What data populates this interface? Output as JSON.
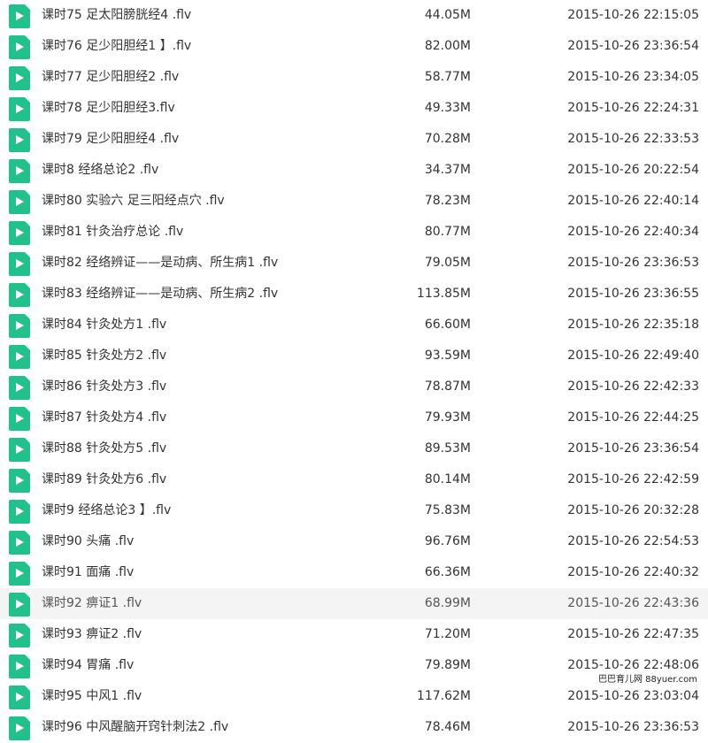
{
  "watermark": "巴巴育儿网 88yuer.com",
  "files": [
    {
      "name": "课时75 足太阳膀胱经4 .flv",
      "size": "44.05M",
      "date": "2015-10-26 22:15:05"
    },
    {
      "name": "课时76 足少阳胆经1 】.flv",
      "size": "82.00M",
      "date": "2015-10-26 23:36:54"
    },
    {
      "name": "课时77 足少阳胆经2 .flv",
      "size": "58.77M",
      "date": "2015-10-26 23:34:05"
    },
    {
      "name": "课时78 足少阳胆经3.flv",
      "size": "49.33M",
      "date": "2015-10-26 22:24:31"
    },
    {
      "name": "课时79 足少阳胆经4 .flv",
      "size": "70.28M",
      "date": "2015-10-26 22:33:53"
    },
    {
      "name": "课时8 经络总论2 .flv",
      "size": "34.37M",
      "date": "2015-10-26 20:22:54"
    },
    {
      "name": "课时80 实验六 足三阳经点穴 .flv",
      "size": "78.23M",
      "date": "2015-10-26 22:40:14"
    },
    {
      "name": "课时81 针灸治疗总论 .flv",
      "size": "80.77M",
      "date": "2015-10-26 22:40:34"
    },
    {
      "name": "课时82 经络辨证——是动病、所生病1 .flv",
      "size": "79.05M",
      "date": "2015-10-26 23:36:53"
    },
    {
      "name": "课时83 经络辨证——是动病、所生病2 .flv",
      "size": "113.85M",
      "date": "2015-10-26 23:36:55"
    },
    {
      "name": "课时84 针灸处方1 .flv",
      "size": "66.60M",
      "date": "2015-10-26 22:35:18"
    },
    {
      "name": "课时85 针灸处方2 .flv",
      "size": "93.59M",
      "date": "2015-10-26 22:49:40"
    },
    {
      "name": "课时86 针灸处方3 .flv",
      "size": "78.87M",
      "date": "2015-10-26 22:42:33"
    },
    {
      "name": "课时87 针灸处方4 .flv",
      "size": "79.93M",
      "date": "2015-10-26 22:44:25"
    },
    {
      "name": "课时88 针灸处方5 .flv",
      "size": "89.53M",
      "date": "2015-10-26 23:36:54"
    },
    {
      "name": "课时89 针灸处方6 .flv",
      "size": "80.14M",
      "date": "2015-10-26 22:42:59"
    },
    {
      "name": "课时9 经络总论3 】.flv",
      "size": "75.83M",
      "date": "2015-10-26 20:32:28"
    },
    {
      "name": "课时90 头痛 .flv",
      "size": "96.76M",
      "date": "2015-10-26 22:54:53"
    },
    {
      "name": "课时91 面痛 .flv",
      "size": "66.36M",
      "date": "2015-10-26 22:40:32"
    },
    {
      "name": "课时92 痹证1 .flv",
      "size": "68.99M",
      "date": "2015-10-26 22:43:36",
      "highlighted": true
    },
    {
      "name": "课时93 痹证2 .flv",
      "size": "71.20M",
      "date": "2015-10-26 22:47:35"
    },
    {
      "name": "课时94 胃痛 .flv",
      "size": "79.89M",
      "date": "2015-10-26 22:48:06"
    },
    {
      "name": "课时95 中风1 .flv",
      "size": "117.62M",
      "date": "2015-10-26 23:03:04"
    },
    {
      "name": "课时96 中风醒脑开窍针刺法2 .flv",
      "size": "78.46M",
      "date": "2015-10-26 23:36:53"
    }
  ]
}
